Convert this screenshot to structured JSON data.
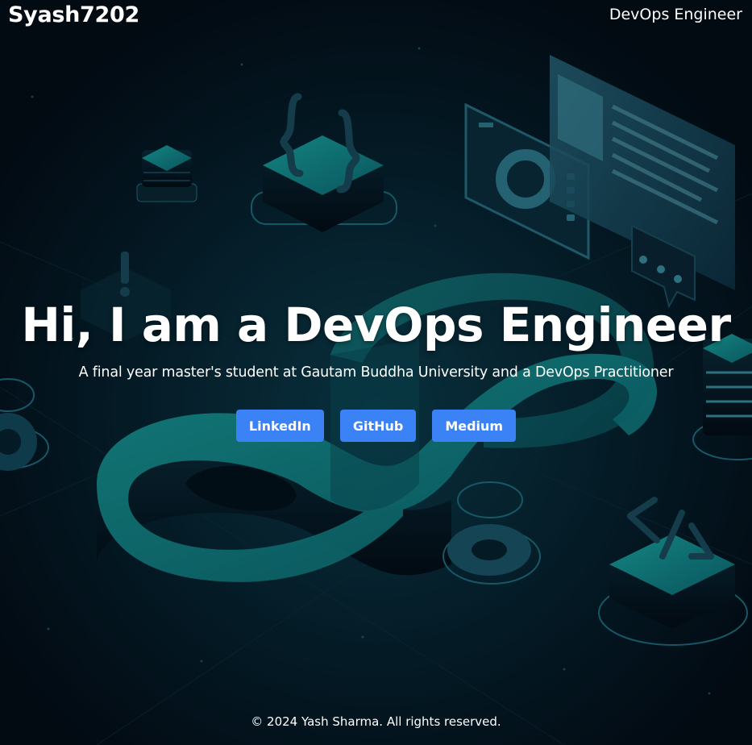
{
  "header": {
    "brand": "Syash7202",
    "tagline": "DevOps Engineer"
  },
  "hero": {
    "title": "Hi, I am a DevOps Engineer",
    "subtitle": "A final year master's student at Gautam Buddha University and a DevOps Practitioner",
    "buttons": [
      {
        "label": "LinkedIn"
      },
      {
        "label": "GitHub"
      },
      {
        "label": "Medium"
      }
    ]
  },
  "footer": {
    "text": "© 2024 Yash Sharma. All rights reserved."
  },
  "theme": {
    "background": "#040d17",
    "accent_teal": "#1aa3a3",
    "button_color": "#3b82f6"
  },
  "icons": [
    "infinity-loop-illustration",
    "server-stack-icon",
    "gear-icon",
    "code-brackets-icon",
    "chart-screen-icon",
    "chat-bubble-icon",
    "document-screen-icon"
  ]
}
